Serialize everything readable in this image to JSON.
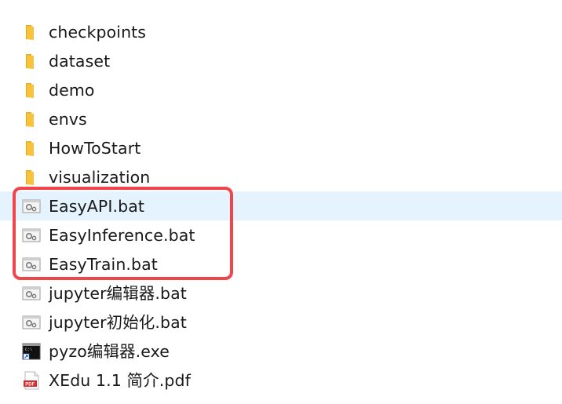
{
  "files": [
    {
      "name": "checkpoints",
      "type": "folder",
      "icon": "folder-icon"
    },
    {
      "name": "dataset",
      "type": "folder",
      "icon": "folder-icon"
    },
    {
      "name": "demo",
      "type": "folder",
      "icon": "folder-icon"
    },
    {
      "name": "envs",
      "type": "folder",
      "icon": "folder-icon"
    },
    {
      "name": "HowToStart",
      "type": "folder",
      "icon": "folder-icon"
    },
    {
      "name": "visualization",
      "type": "folder",
      "icon": "folder-icon"
    },
    {
      "name": "EasyAPI.bat",
      "type": "bat",
      "icon": "batch-file-icon",
      "selected": true
    },
    {
      "name": "EasyInference.bat",
      "type": "bat",
      "icon": "batch-file-icon"
    },
    {
      "name": "EasyTrain.bat",
      "type": "bat",
      "icon": "batch-file-icon"
    },
    {
      "name": "jupyter编辑器.bat",
      "type": "bat",
      "icon": "batch-file-icon"
    },
    {
      "name": "jupyter初始化.bat",
      "type": "bat",
      "icon": "batch-file-icon"
    },
    {
      "name": "pyzo编辑器.exe",
      "type": "exe",
      "icon": "console-shortcut-icon"
    },
    {
      "name": "XEdu 1.1 简介.pdf",
      "type": "pdf",
      "icon": "pdf-icon",
      "icon_text": "PDF"
    }
  ],
  "colors": {
    "folder": "#f8c33a",
    "selection": "#e5f3ff",
    "highlight_border": "#f0454a"
  }
}
